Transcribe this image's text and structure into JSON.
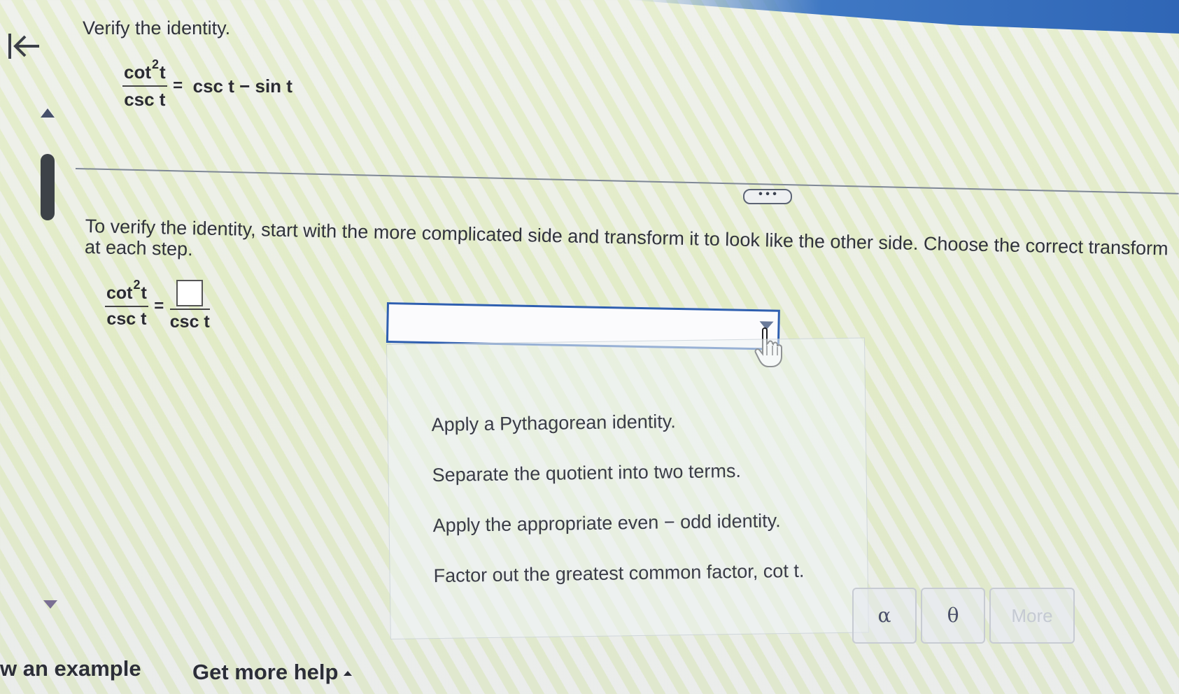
{
  "problem": {
    "instruction": "Verify the identity.",
    "lhs_num": "cot",
    "lhs_exp": "2",
    "lhs_num_var": "t",
    "lhs_den": "csc t",
    "rhs": "csc t − sin t"
  },
  "step": {
    "description": "To verify the identity, start with the more complicated side and transform it to look like the other side. Choose the correct transformation and transform the expression at each step.",
    "desc_line1": "To verify the identity, start with the more complicated side and transform it to look like the other side. Choose the correct transform",
    "desc_line2": "at each step.",
    "lhs_num": "cot",
    "lhs_exp": "2",
    "lhs_num_var": "t",
    "lhs_den": "csc t",
    "equals": "=",
    "rhs_den": "csc t"
  },
  "dropdown": {
    "selected": "",
    "options": [
      "Apply a Pythagorean identity.",
      "Separate the quotient into two terms.",
      "Apply the appropriate even − odd identity.",
      "Factor out the greatest common factor, cot t."
    ]
  },
  "divider_more": "• • •",
  "palette": {
    "alpha": "α",
    "theta": "θ",
    "more": "More"
  },
  "footer": {
    "example": "w an example",
    "help": "Get more help"
  },
  "colors": {
    "accent": "#2f5fb0",
    "text": "#30323c"
  }
}
